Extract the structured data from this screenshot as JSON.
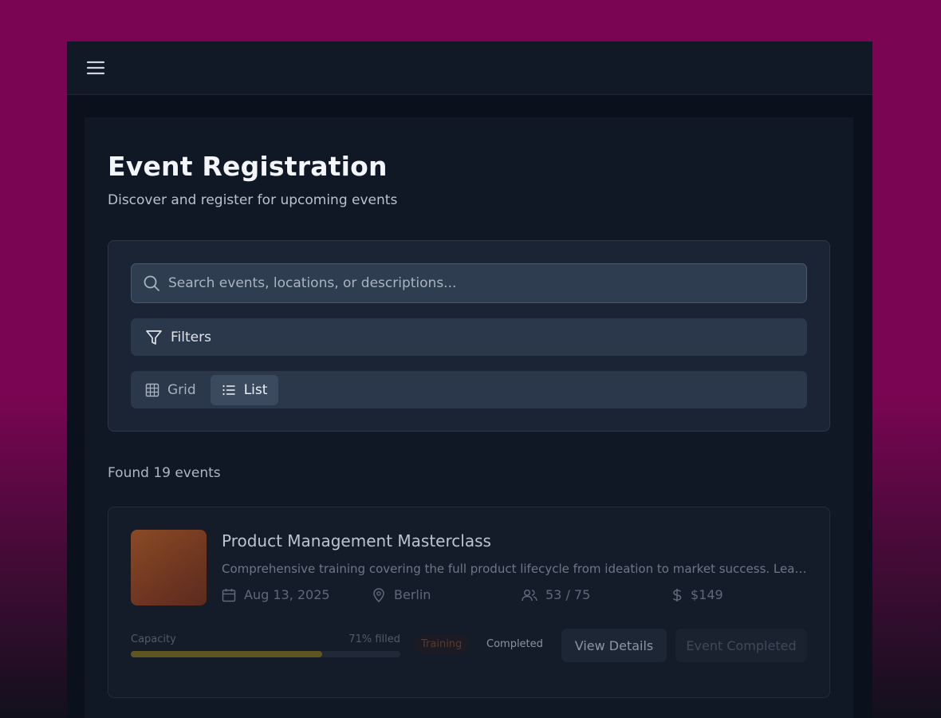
{
  "header": {
    "menu_icon": "hamburger-icon"
  },
  "page": {
    "title": "Event Registration",
    "subtitle": "Discover and register for upcoming events"
  },
  "search": {
    "placeholder": "Search events, locations, or descriptions...",
    "icon": "search-icon"
  },
  "filters": {
    "label": "Filters",
    "icon": "filter-icon"
  },
  "view_toggle": {
    "grid_label": "Grid",
    "list_label": "List",
    "selected": "List"
  },
  "results": {
    "found_text": "Found 19 events"
  },
  "events": [
    {
      "title": "Product Management Masterclass",
      "description": "Comprehensive training covering the full product lifecycle from ideation to market success. Learn...",
      "date": "Aug 13, 2025",
      "location": "Berlin",
      "attendees": "53 / 75",
      "price": "$149",
      "capacity_label": "Capacity",
      "capacity_filled_text": "71% filled",
      "capacity_fraction": 0.71,
      "category": "Training",
      "status": "Completed",
      "details_button": "View Details",
      "action_button": "Event Completed"
    }
  ],
  "colors": {
    "background_magenta": "#7a0552",
    "app_bg": "#0b111c",
    "panel_bg": "#1a2434",
    "capacity_fill": "#5e5520",
    "category_text": "#5c3a2d"
  }
}
